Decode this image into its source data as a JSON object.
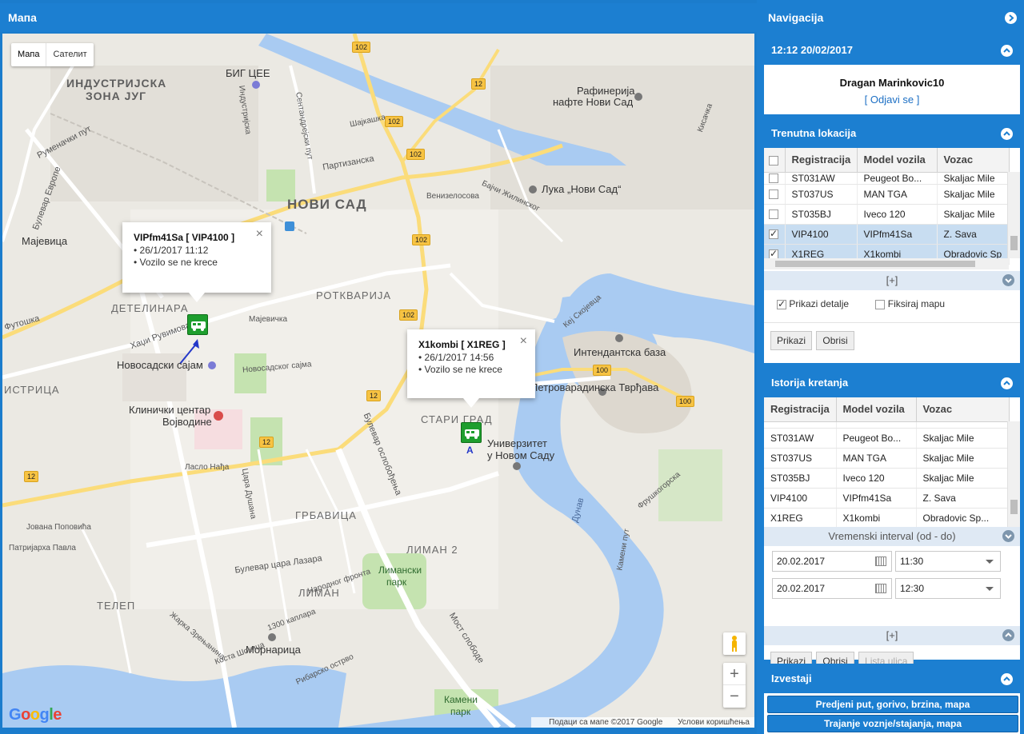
{
  "map": {
    "title": "Мапа",
    "map_type": {
      "map": "Мапа",
      "satellite": "Сателит"
    },
    "districts": [
      "ИНДУСТРИЈСКА",
      "ЗОНА ЈУГ",
      "НОВИ САД",
      "ДЕТЕЛИНАРА",
      "РОТКВАРИЈА",
      "СТАРИ ГРАД",
      "ГРБАВИЦА",
      "ЛИМАН 2",
      "ЛИМАН",
      "ТЕЛЕП",
      "ИСТРИЦА"
    ],
    "pois": [
      "БИГ ЦЕЕ",
      "Рафинерија",
      "нафте Нови Сад",
      "Лука „Нови Сад“",
      "Мајевица",
      "Новосадски сајам",
      "Клинички центар",
      "Војводине",
      "Интендантска база",
      "Петроварадинска Тврђава",
      "Универзитет",
      "у Новом Саду",
      "Мoрнарица",
      "Лимански",
      "парк",
      "Камени",
      "парк"
    ],
    "streets": [
      "Партизанска",
      "Руменачки пут",
      "Булевар Европе",
      "Хаџи Рувимова",
      "Новосадског сајма",
      "Мајевичка",
      "Булевар ослобођења",
      "Булевар цара Лазара",
      "Мост слободе",
      "Дунав",
      "Кеј Скојевца",
      "Народног фронта",
      "Јована Поповића",
      "Футошка",
      "Шајкашка",
      "Индустријска",
      "Сентандрејски пут",
      "Венизелосова",
      "Бајчи Жилинског",
      "Цара Душана",
      "Ласло Нађа",
      "Рибарско острво",
      "1300 каплара",
      "Коста Шокица",
      "Жарка Зрењанина",
      "Патријарха Павла",
      "Фрушкогорска",
      "Камени пут",
      "Кисачка"
    ],
    "road_shields": [
      "102",
      "102",
      "12",
      "102",
      "102",
      "102",
      "12",
      "12",
      "12",
      "100",
      "100",
      "12"
    ],
    "popups": [
      {
        "title": "VIPfm41Sa [ VIP4100 ]",
        "lines": [
          "• 26/1/2017 11:12",
          "• Vozilo se ne krece"
        ]
      },
      {
        "title": "X1kombi [ X1REG ]",
        "lines": [
          "• 26/1/2017 14:56",
          "• Vozilo se ne krece"
        ]
      }
    ],
    "close_symbol": "×",
    "marker_letter": "A",
    "zoom": {
      "in": "+",
      "out": "−"
    },
    "footer": {
      "data": "Подаци са мапе ©2017 Google",
      "terms": "Услови коришћења"
    },
    "logo": "Google"
  },
  "navigation": {
    "title": "Navigacija",
    "datetime": "12:12 20/02/2017",
    "user": "Dragan Marinkovic10",
    "logout": "[ Odjavi se ]"
  },
  "current_location": {
    "title": "Trenutna lokacija",
    "columns": [
      "Registracija",
      "Model vozila",
      "Vozac"
    ],
    "rows": [
      {
        "reg": "ST031AW",
        "model": "Peugeot Bo...",
        "driver": "Skaljac Mile",
        "checked": false
      },
      {
        "reg": "ST037US",
        "model": "MAN TGA",
        "driver": "Skaljac Mile",
        "checked": false
      },
      {
        "reg": "ST035BJ",
        "model": "Iveco 120",
        "driver": "Skaljac Mile",
        "checked": false
      },
      {
        "reg": "VIP4100",
        "model": "VIPfm41Sa",
        "driver": "Z. Sava",
        "checked": true
      },
      {
        "reg": "X1REG",
        "model": "X1kombi",
        "driver": "Obradovic Sp",
        "checked": true
      }
    ],
    "expand": "[+]",
    "show_details": "Prikazi detalje",
    "fix_map": "Fiksiraj mapu",
    "show_details_checked": true,
    "fix_map_checked": false,
    "btn_show": "Prikazi",
    "btn_delete": "Obrisi"
  },
  "history": {
    "title": "Istorija kretanja",
    "columns": [
      "Registracija",
      "Model vozila",
      "Vozac"
    ],
    "rows": [
      {
        "reg": "ST031AW",
        "model": "Peugeot Bo...",
        "driver": "Skaljac Mile"
      },
      {
        "reg": "ST037US",
        "model": "MAN TGA",
        "driver": "Skaljac Mile"
      },
      {
        "reg": "ST035BJ",
        "model": "Iveco 120",
        "driver": "Skaljac Mile"
      },
      {
        "reg": "VIP4100",
        "model": "VIPfm41Sa",
        "driver": "Z. Sava"
      },
      {
        "reg": "X1REG",
        "model": "X1kombi",
        "driver": "Obradovic Sp..."
      }
    ],
    "interval_label": "Vremenski interval (od - do)",
    "from_date": "20.02.2017",
    "from_time": "11:30",
    "to_date": "20.02.2017",
    "to_time": "12:30",
    "expand": "[+]",
    "btn_show": "Prikazi",
    "btn_delete": "Obrisi",
    "btn_streets": "Lista ulica"
  },
  "reports": {
    "title": "Izvestaji",
    "items": [
      "Predjeni put, gorivo, brzina, mapa",
      "Trajanje voznje/stajanja, mapa"
    ]
  },
  "colors": {
    "accent": "#1c7fd1",
    "selected_row": "#c8ddf1",
    "vehicle": "#1e9e2e",
    "water": "#a9cbf2",
    "park": "#c5e3b0"
  }
}
